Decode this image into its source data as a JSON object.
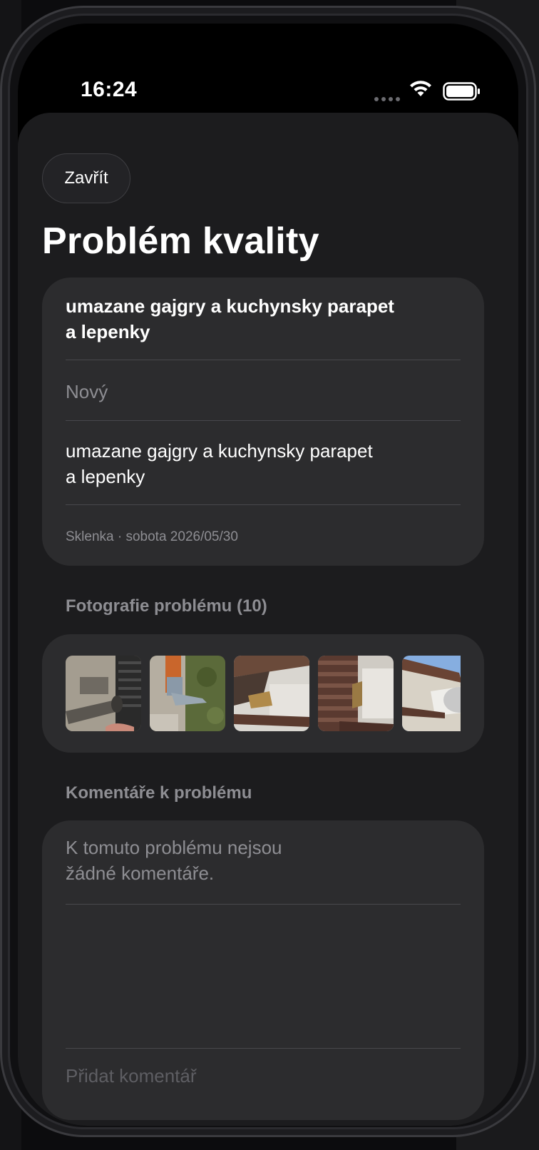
{
  "status_bar": {
    "time": "16:24"
  },
  "header": {
    "close_label": "Zavřít",
    "title": "Problém kvality"
  },
  "issue": {
    "title_line1": "umazane gajgry a kuchynsky parapet",
    "title_line2": "a lepenky",
    "status": "Nový",
    "description_line1": "umazane gajgry a kuchynsky parapet",
    "description_line2": "a lepenky",
    "meta": "Sklenka · sobota 2026/05/30"
  },
  "photos": {
    "header": "Fotografie problému (10)",
    "count": 10
  },
  "comments": {
    "header": "Komentáře k problému",
    "empty_line1": "K tomuto problému nejsou",
    "empty_line2": "žádné komentáře.",
    "add_placeholder": "Přidat komentář"
  }
}
